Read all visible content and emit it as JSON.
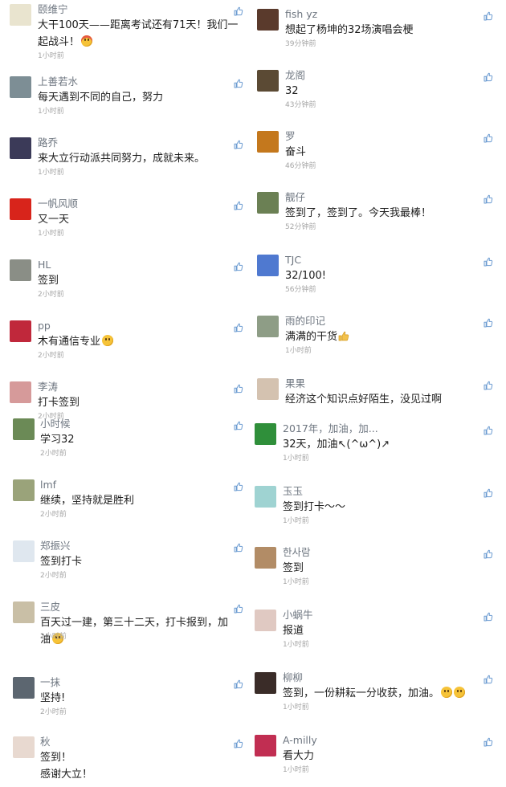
{
  "left_comments": [
    {
      "name": "颐维宁",
      "text": "大干100天——距离考试还有71天！我们一起战斗！",
      "emoji": "face-with-headband-emoji",
      "time": "1小时前",
      "avatar_color": "#e9e4cf"
    },
    {
      "name": "上善若水",
      "text": "每天遇到不同的自己，努力",
      "time": "1小时前",
      "avatar_color": "#7d8e95"
    },
    {
      "name": "路乔",
      "text": "来大立行动派共同努力，成就未来。",
      "time": "1小时前",
      "avatar_color": "#3b3a58"
    },
    {
      "name": "一帆风顺",
      "text": "又一天",
      "time": "1小时前",
      "avatar_color": "#d8241b"
    },
    {
      "name": "HL",
      "text": "签到",
      "time": "2小时前",
      "avatar_color": "#8a8e86"
    },
    {
      "name": "pp",
      "text": "木有通信专业",
      "emoji": "sad-face-emoji",
      "time": "2小时前",
      "avatar_color": "#c0283b"
    },
    {
      "name": "李涛",
      "text": "打卡签到",
      "time": "2小时前",
      "avatar_color": "#d69a9a"
    },
    {
      "name": "小时候",
      "text": "学习32",
      "time": "2小时前",
      "avatar_color": "#6b8a56"
    },
    {
      "name": "lmf",
      "text": "继续，坚持就是胜利",
      "time": "2小时前",
      "avatar_color": "#9aa37a"
    },
    {
      "name": "郑振兴",
      "text": "签到打卡",
      "time": "2小时前",
      "avatar_color": "#dfe7ef"
    },
    {
      "name": "三皮",
      "text": "百天过一建，第三十二天，打卡报到，加油",
      "emoji": "smile-emoji",
      "time": "2小时前",
      "avatar_color": "#c9bfa6"
    },
    {
      "name": "一抹",
      "text": "坚持!",
      "time": "2小时前",
      "avatar_color": "#5c6670"
    },
    {
      "name": "秋",
      "text": "签到！\n感谢大立！",
      "time": "",
      "avatar_color": "#e8d9d0"
    }
  ],
  "right_comments": [
    {
      "name": "fish yz",
      "text": "想起了杨坤的32场演唱会梗",
      "time": "39分钟前",
      "avatar_color": "#5a3a2c"
    },
    {
      "name": "龙阁",
      "text": "32",
      "time": "43分钟前",
      "avatar_color": "#5b4a34"
    },
    {
      "name": "罗",
      "text": "奋斗",
      "time": "46分钟前",
      "avatar_color": "#c4781d"
    },
    {
      "name": "靓仔",
      "text": "签到了，签到了。今天我最棒！",
      "time": "52分钟前",
      "avatar_color": "#6b8054"
    },
    {
      "name": "TJC",
      "text": "32/100!",
      "time": "56分钟前",
      "avatar_color": "#4f79d0"
    },
    {
      "name": "雨的印记",
      "text": "满满的干货",
      "emoji": "thumbs-up-emoji",
      "time": "1小时前",
      "avatar_color": "#8e9d86"
    },
    {
      "name": "果果",
      "text": "经济这个知识点好陌生，没见过啊",
      "time": "",
      "avatar_color": "#d4c2b0"
    },
    {
      "name": "2017年，加油，加...",
      "text": "32天，加油↖(^ω^)↗",
      "time": "1小时前",
      "avatar_color": "#2f8f3a"
    },
    {
      "name": "玉玉",
      "text": "签到打卡～～",
      "time": "1小时前",
      "avatar_color": "#9fd3d2"
    },
    {
      "name": "한사람",
      "text": "签到",
      "time": "1小时前",
      "avatar_color": "#b28c66"
    },
    {
      "name": "小蜗牛",
      "text": "报道",
      "time": "1小时前",
      "avatar_color": "#e0c9c2"
    },
    {
      "name": "柳柳",
      "text": "签到，一份耕耘一分收获，加油。",
      "emoji": "double-smile-emoji",
      "time": "1小时前",
      "avatar_color": "#3a2c28"
    },
    {
      "name": "A-milly",
      "text": "看大力",
      "time": "1小时前",
      "avatar_color": "#c12e52"
    }
  ],
  "icons": {
    "like": "thumbs-up-like-icon"
  },
  "colors": {
    "name": "#6e7680",
    "text": "#1d1d1d",
    "time": "#a6a6a6",
    "like": "#6b9bd1"
  }
}
